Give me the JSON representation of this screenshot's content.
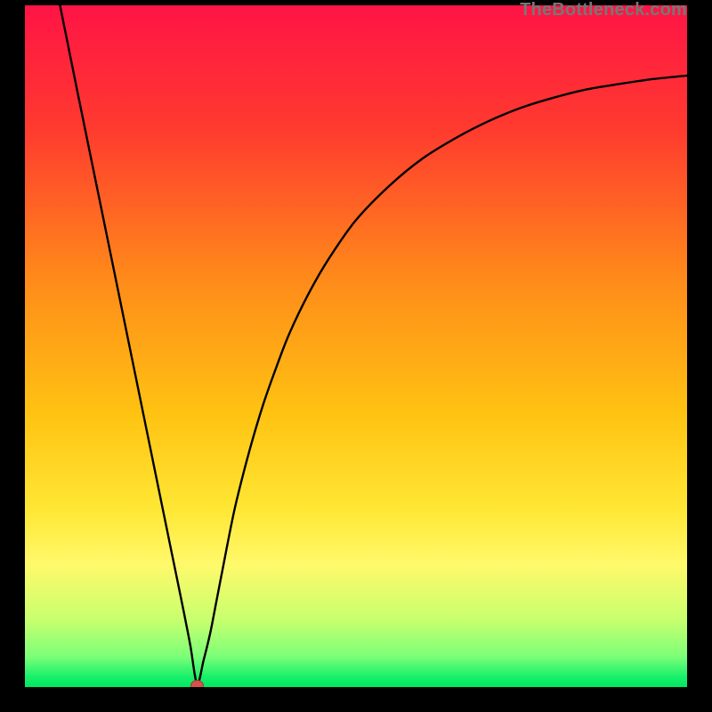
{
  "attribution": "TheBottleneck.com",
  "colors": {
    "frame": "#000000",
    "curve": "#000000",
    "dot_fill": "#d2544b",
    "dot_stroke": "#a83a32",
    "gradient_stops": [
      {
        "offset": 0.0,
        "color": "#ff1445"
      },
      {
        "offset": 0.18,
        "color": "#ff3a2f"
      },
      {
        "offset": 0.4,
        "color": "#ff8a1a"
      },
      {
        "offset": 0.6,
        "color": "#ffc312"
      },
      {
        "offset": 0.74,
        "color": "#ffe735"
      },
      {
        "offset": 0.82,
        "color": "#fff96b"
      },
      {
        "offset": 0.9,
        "color": "#c9ff6e"
      },
      {
        "offset": 0.955,
        "color": "#7dff78"
      },
      {
        "offset": 0.985,
        "color": "#18f06a"
      },
      {
        "offset": 1.0,
        "color": "#00e85e"
      }
    ]
  },
  "chart_data": {
    "type": "line",
    "title": "",
    "xlabel": "",
    "ylabel": "",
    "xlim": [
      0,
      100
    ],
    "ylim": [
      0,
      100
    ],
    "legend": false,
    "grid": false,
    "min_point": {
      "x": 26,
      "y": 0
    },
    "series": [
      {
        "name": "bottleneck-curve",
        "x": [
          5.3,
          8,
          10,
          12,
          14,
          16,
          18,
          20,
          22,
          24,
          25,
          26,
          27,
          28,
          29,
          30,
          31,
          32,
          34,
          36,
          38,
          40,
          43,
          46,
          50,
          55,
          60,
          65,
          70,
          75,
          80,
          85,
          90,
          95,
          100
        ],
        "y": [
          100,
          87,
          77.5,
          68,
          58.5,
          49,
          39.5,
          30,
          20.5,
          11,
          6,
          0.5,
          4,
          8,
          13,
          18,
          23,
          27.5,
          35,
          41.5,
          47,
          52,
          58,
          63,
          68.5,
          73.5,
          77.5,
          80.5,
          83,
          85,
          86.5,
          87.7,
          88.5,
          89.2,
          89.7
        ]
      }
    ]
  }
}
